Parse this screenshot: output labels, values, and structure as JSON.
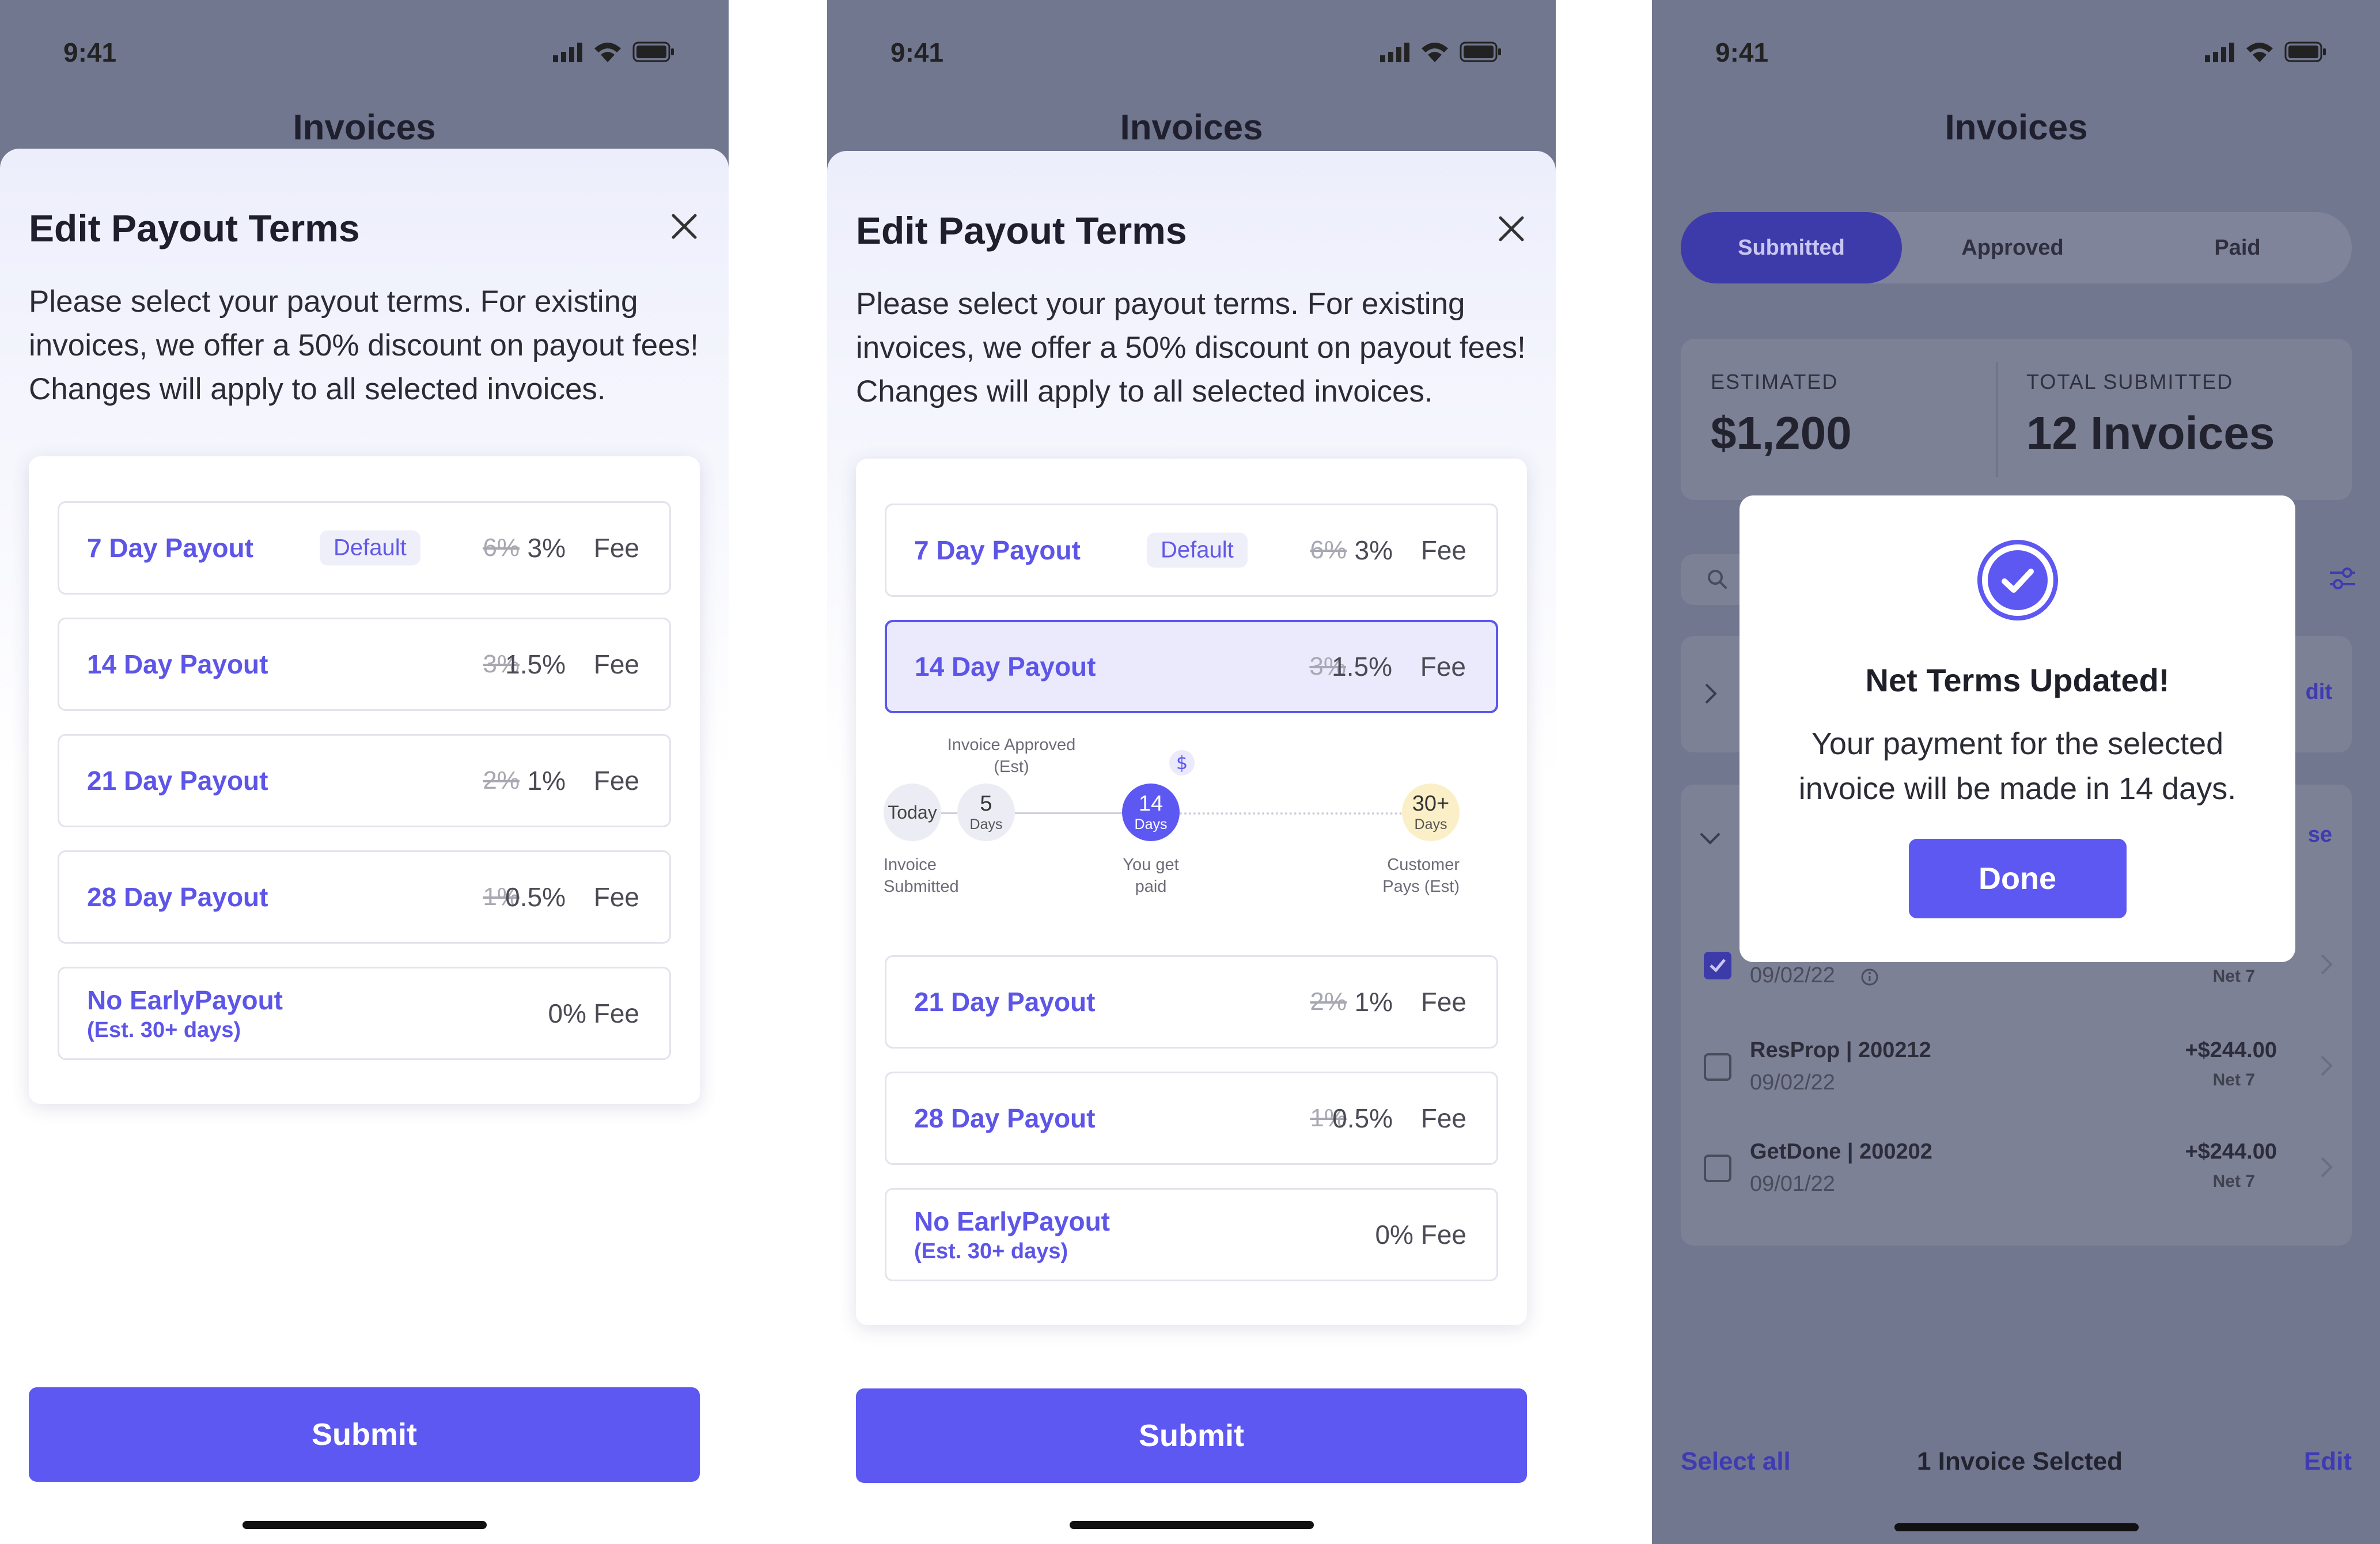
{
  "status": {
    "time": "9:41"
  },
  "screen_title": "Invoices",
  "sheet": {
    "title": "Edit Payout Terms",
    "description": "Please select your payout terms.  For existing invoices, we offer a 50% discount on payout fees! Changes will apply to all selected invoices.",
    "default_badge": "Default",
    "options": [
      {
        "label": "7 Day Payout",
        "old_fee": "6%",
        "new_fee": "3%",
        "fee_word": "Fee"
      },
      {
        "label": "14 Day Payout",
        "old_fee": "3%",
        "new_fee": "1.5%",
        "fee_word": "Fee"
      },
      {
        "label": "21 Day Payout",
        "old_fee": "2%",
        "new_fee": "1%",
        "fee_word": "Fee"
      },
      {
        "label": "28 Day Payout",
        "old_fee": "1%",
        "new_fee": "0.5%",
        "fee_word": "Fee"
      },
      {
        "label": "No EarlyPayout",
        "sub": "(Est. 30+ days)",
        "fee": "0% Fee"
      }
    ],
    "selected_option_screen2": "14 Day Payout",
    "submit_label": "Submit"
  },
  "timeline": {
    "today": "Today",
    "step2_num": "5",
    "step2_unit": "Days",
    "step2_caption": "Invoice Approved (Est)",
    "step3_num": "14",
    "step3_unit": "Days",
    "step3_icon": "$",
    "step3_caption": "You get paid",
    "step4_num": "30+",
    "step4_unit": "Days",
    "step4_caption": "Customer Pays (Est)",
    "start_caption": "Invoice Submitted"
  },
  "invoices_screen": {
    "tabs": [
      "Submitted",
      "Approved",
      "Paid"
    ],
    "active_tab": "Submitted",
    "estimated_label": "ESTIMATED",
    "estimated_value": "$1,200",
    "total_label": "TOTAL SUBMITTED",
    "total_value": "12 Invoices",
    "edit_peek": "dit",
    "close_peek": "se",
    "rows": [
      {
        "date": "09/02/22",
        "net": "Net 7",
        "checked": true
      },
      {
        "name": "ResProp | 200212",
        "date": "09/02/22",
        "amount": "+$244.00",
        "net": "Net 7",
        "checked": false
      },
      {
        "name": "GetDone | 200202",
        "date": "09/01/22",
        "amount": "+$244.00",
        "net": "Net 7",
        "checked": false
      }
    ],
    "select_all": "Select all",
    "selected_count": "1 Invoice Selcted",
    "edit_label": "Edit"
  },
  "modal": {
    "title": "Net Terms Updated!",
    "body": "Your payment for the selected invoice will be made in 14 days.",
    "done_label": "Done"
  },
  "colors": {
    "accent": "#5d58f2",
    "label": "#5d55e8",
    "dim_overlay": "#727790"
  }
}
